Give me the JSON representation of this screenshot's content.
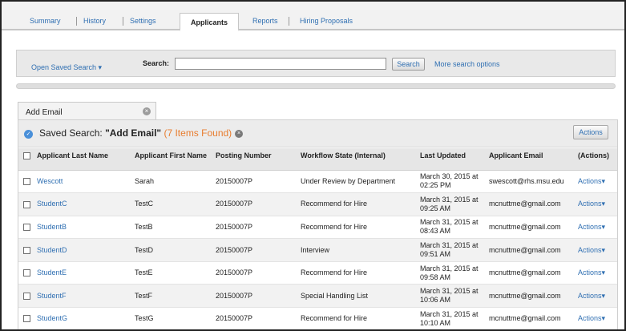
{
  "tabs": [
    {
      "label": "Summary"
    },
    {
      "label": "History"
    },
    {
      "label": "Settings"
    },
    {
      "label": "Applicants"
    },
    {
      "label": "Reports"
    },
    {
      "label": "Hiring Proposals"
    }
  ],
  "active_tab": "Applicants",
  "search": {
    "saved_search_link": "Open Saved Search ▾",
    "label": "Search:",
    "value": "",
    "placeholder": "",
    "button_label": "Search",
    "more_options": "More search options"
  },
  "saved_search_tab": {
    "label": "Add Email"
  },
  "results_header": {
    "prefix": "Saved Search: ",
    "name": "\"Add Email\"",
    "count": "(7 Items Found)",
    "actions_label": "Actions"
  },
  "table": {
    "columns": [
      "Applicant Last Name",
      "Applicant First Name",
      "Posting Number",
      "Workflow State (Internal)",
      "Last Updated",
      "Applicant Email",
      "(Actions)"
    ],
    "rows": [
      {
        "last": "Wescott",
        "first": "Sarah",
        "posting": "20150007P",
        "workflow": "Under Review by Department",
        "updated": "March 30, 2015 at 02:25 PM",
        "email": "swescott@rhs.msu.edu",
        "action": "Actions▾"
      },
      {
        "last": "StudentC",
        "first": "TestC",
        "posting": "20150007P",
        "workflow": "Recommend for Hire",
        "updated": "March 31, 2015 at 09:25 AM",
        "email": "mcnuttme@gmail.com",
        "action": "Actions▾"
      },
      {
        "last": "StudentB",
        "first": "TestB",
        "posting": "20150007P",
        "workflow": "Recommend for Hire",
        "updated": "March 31, 2015 at 08:43 AM",
        "email": "mcnuttme@gmail.com",
        "action": "Actions▾"
      },
      {
        "last": "StudentD",
        "first": "TestD",
        "posting": "20150007P",
        "workflow": "Interview",
        "updated": "March 31, 2015 at 09:51 AM",
        "email": "mcnuttme@gmail.com",
        "action": "Actions▾"
      },
      {
        "last": "StudentE",
        "first": "TestE",
        "posting": "20150007P",
        "workflow": "Recommend for Hire",
        "updated": "March 31, 2015 at 09:58 AM",
        "email": "mcnuttme@gmail.com",
        "action": "Actions▾"
      },
      {
        "last": "StudentF",
        "first": "TestF",
        "posting": "20150007P",
        "workflow": "Special Handling List",
        "updated": "March 31, 2015 at 10:06 AM",
        "email": "mcnuttme@gmail.com",
        "action": "Actions▾"
      },
      {
        "last": "StudentG",
        "first": "TestG",
        "posting": "20150007P",
        "workflow": "Recommend for Hire",
        "updated": "March 31, 2015 at 10:10 AM",
        "email": "mcnuttme@gmail.com",
        "action": "Actions▾"
      }
    ]
  },
  "icons": {
    "info": "info-icon",
    "close": "close-icon",
    "checkbox": "checkbox-icon"
  },
  "colors": {
    "link": "#2f6fb2",
    "count": "#e87d2f",
    "info_icon": "#4a90d9"
  }
}
